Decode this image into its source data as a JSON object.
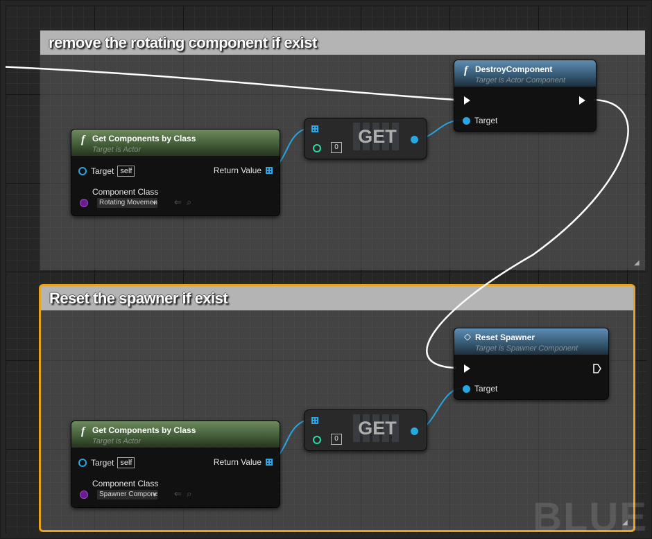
{
  "comments": [
    {
      "title": "remove the rotating component if exist"
    },
    {
      "title": "Reset the spawner if exist"
    }
  ],
  "nodes": {
    "get_components_1": {
      "title": "Get Components by Class",
      "subtitle": "Target is Actor",
      "target_label": "Target",
      "self_label": "self",
      "return_label": "Return Value",
      "component_class_label": "Component Class",
      "component_class_value": "Rotating Movemen"
    },
    "get_array_1": {
      "label": "GET",
      "index": "0"
    },
    "destroy_component": {
      "title": "DestroyComponent",
      "subtitle": "Target is Actor Component",
      "target_label": "Target"
    },
    "get_components_2": {
      "title": "Get Components by Class",
      "subtitle": "Target is Actor",
      "target_label": "Target",
      "self_label": "self",
      "return_label": "Return Value",
      "component_class_label": "Component Class",
      "component_class_value": "Spawner Compone"
    },
    "get_array_2": {
      "label": "GET",
      "index": "0"
    },
    "reset_spawner": {
      "title": "Reset Spawner",
      "subtitle": "Target is Spawner Component",
      "target_label": "Target"
    }
  },
  "watermark": "BLUE",
  "colors": {
    "object_pin": "#26a7e0",
    "exec_wire": "#ffffff",
    "class_pin": "#6a1c8e",
    "selected_comment": "#e9a21c",
    "function_header": "#6e8a5e",
    "member_header": "#5f8db5"
  },
  "icons": [
    "function-icon",
    "event-diamond-icon",
    "exec-pin-icon",
    "array-grid-icon",
    "object-pin-icon",
    "class-pin-icon",
    "browse-arrow-icon",
    "search-icon",
    "resize-grip-icon"
  ]
}
